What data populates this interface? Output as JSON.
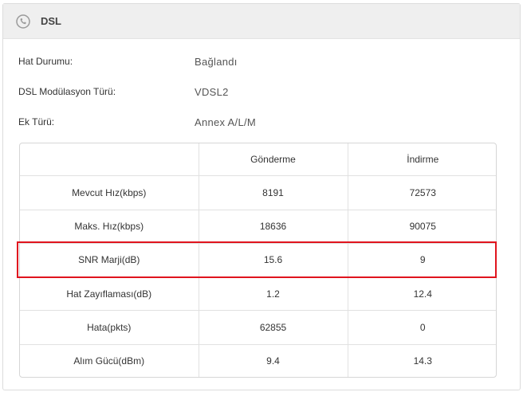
{
  "header": {
    "title": "DSL",
    "icon": "phone-icon"
  },
  "info": [
    {
      "label": "Hat Durumu:",
      "value": "Bağlandı"
    },
    {
      "label": "DSL Modülasyon Türü:",
      "value": "VDSL2"
    },
    {
      "label": "Ek Türü:",
      "value": "Annex A/L/M"
    }
  ],
  "table": {
    "columns": [
      "",
      "Gönderme",
      "İndirme"
    ],
    "rows": [
      {
        "name": "Mevcut Hız(kbps)",
        "up": "8191",
        "down": "72573"
      },
      {
        "name": "Maks. Hız(kbps)",
        "up": "18636",
        "down": "90075"
      },
      {
        "name": "SNR Marji(dB)",
        "up": "15.6",
        "down": "9"
      },
      {
        "name": "Hat Zayıflaması(dB)",
        "up": "1.2",
        "down": "12.4"
      },
      {
        "name": "Hata(pkts)",
        "up": "62855",
        "down": "0"
      },
      {
        "name": "Alım Gücü(dBm)",
        "up": "9.4",
        "down": "14.3"
      }
    ]
  },
  "highlight_color": "#e0141e"
}
